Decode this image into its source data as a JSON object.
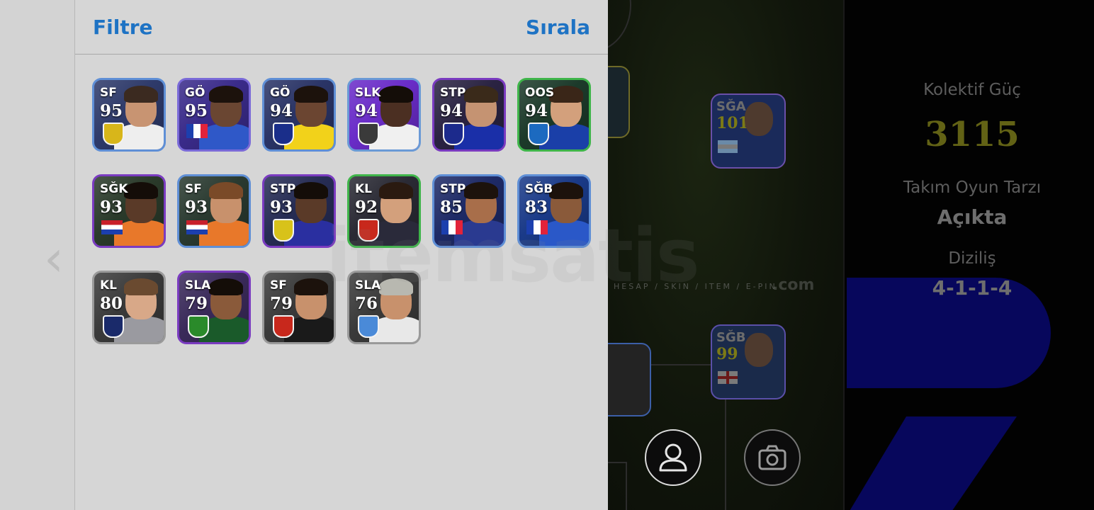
{
  "header": {
    "filter_label": "Filtre",
    "sort_label": "Sırala"
  },
  "nav": {
    "back_icon": "chevron-left-icon"
  },
  "players": [
    {
      "pos": "SF",
      "ovr": "95",
      "badge": "crest",
      "frame": "#5f8fd6",
      "bg": "#2e3a6a",
      "shirt": "#eeeeee",
      "skin": "#c89472",
      "hair": "#3b2a20",
      "crest": "#d8b61a"
    },
    {
      "pos": "GÖ",
      "ovr": "95",
      "badge": "flag-fr",
      "frame": "#7a6ad8",
      "bg": "#3a2b8a",
      "shirt": "#2f58c8",
      "skin": "#6a4632",
      "hair": "#1c120c",
      "crest": "#ffffff"
    },
    {
      "pos": "GÖ",
      "ovr": "94",
      "badge": "crest",
      "frame": "#5f8fd6",
      "bg": "#2a3466",
      "shirt": "#f2d21a",
      "skin": "#6b4531",
      "hair": "#1c120c",
      "crest": "#1a2e8a"
    },
    {
      "pos": "SLK",
      "ovr": "94",
      "badge": "crest",
      "frame": "#6a9ad6",
      "bg": "#6a2cc8",
      "shirt": "#f0f0f0",
      "skin": "#4b2f22",
      "hair": "#140d08",
      "crest": "#3a3a3a"
    },
    {
      "pos": "STP",
      "ovr": "94",
      "badge": "crest",
      "frame": "#7a3bc0",
      "bg": "#2a2342",
      "shirt": "#1a2fa8",
      "skin": "#c59372",
      "hair": "#3a2a1a",
      "crest": "#1c2a8c"
    },
    {
      "pos": "OOS",
      "ovr": "94",
      "badge": "crest",
      "frame": "#3fb54a",
      "bg": "#1c3a2a",
      "shirt": "#1a3fa8",
      "skin": "#d3a07c",
      "hair": "#3a2618",
      "crest": "#1c6ac0"
    },
    {
      "pos": "SĞK",
      "ovr": "93",
      "badge": "flag-nl",
      "frame": "#7a3bc0",
      "bg": "#2a3a2a",
      "shirt": "#e8782a",
      "skin": "#5a3a28",
      "hair": "#140d08",
      "crest": "#ffffff"
    },
    {
      "pos": "SF",
      "ovr": "93",
      "badge": "flag-nl",
      "frame": "#5f8fd6",
      "bg": "#2a3a30",
      "shirt": "#e8782a",
      "skin": "#c8916c",
      "hair": "#7a4a28",
      "crest": "#ffffff"
    },
    {
      "pos": "STP",
      "ovr": "93",
      "badge": "crest",
      "frame": "#7a3bc0",
      "bg": "#262c54",
      "shirt": "#2a2fa0",
      "skin": "#5a3a28",
      "hair": "#140d08",
      "crest": "#d8c21a"
    },
    {
      "pos": "KL",
      "ovr": "92",
      "badge": "crest",
      "frame": "#3fb54a",
      "bg": "#2a2a34",
      "shirt": "#2a2a3a",
      "skin": "#d3a07c",
      "hair": "#2a1a10",
      "crest": "#c8281c"
    },
    {
      "pos": "STP",
      "ovr": "85",
      "badge": "flag-fr",
      "frame": "#5f8fd6",
      "bg": "#1e2a66",
      "shirt": "#2a3a90",
      "skin": "#a86e4a",
      "hair": "#1c120c",
      "crest": "#ffffff"
    },
    {
      "pos": "SĞB",
      "ovr": "83",
      "badge": "flag-fr",
      "frame": "#5f8fd6",
      "bg": "#1a3a88",
      "shirt": "#2a58c8",
      "skin": "#8a5a3a",
      "hair": "#1c120c",
      "crest": "#ffffff"
    },
    {
      "pos": "KL",
      "ovr": "80",
      "badge": "crest",
      "frame": "#9a9a9a",
      "bg": "#3a3a3a",
      "shirt": "#9a9aa0",
      "skin": "#d8a888",
      "hair": "#6a4a30",
      "crest": "#1a2a6a"
    },
    {
      "pos": "SLA",
      "ovr": "79",
      "badge": "crest",
      "frame": "#7a3bc0",
      "bg": "#3a2a5a",
      "shirt": "#1a5a2a",
      "skin": "#8a5a3a",
      "hair": "#140d08",
      "crest": "#2a8a2a"
    },
    {
      "pos": "SF",
      "ovr": "79",
      "badge": "crest",
      "frame": "#9a9a9a",
      "bg": "#3a3a3a",
      "shirt": "#1a1a1a",
      "skin": "#c8916c",
      "hair": "#1c120c",
      "crest": "#c8281c"
    },
    {
      "pos": "SLA",
      "ovr": "76",
      "badge": "crest",
      "frame": "#9a9a9a",
      "bg": "#3a3a3a",
      "shirt": "#e8e8e8",
      "skin": "#c8916c",
      "hair": "#b8b8b0",
      "crest": "#4a8ad8"
    }
  ],
  "team": {
    "power_label": "Kolektif Güç",
    "power_value": "3115",
    "style_label": "Takım Oyun Tarzı",
    "style_value": "Açıkta",
    "formation_label": "Diziliş",
    "formation_value": "4-1-1-4"
  },
  "lineup": [
    {
      "pos": "SĞA",
      "ovr": "101",
      "badge": "flag-ar"
    },
    {
      "pos": "SĞB",
      "ovr": "99",
      "badge": "flag-en"
    }
  ],
  "watermark": {
    "brand": "itemsatis",
    "tagline": "HESAP / SKIN / ITEM / E-PIN",
    "suffix": ".com"
  },
  "buttons": {
    "profile_icon": "user-icon",
    "camera_icon": "camera-icon"
  },
  "colors": {
    "accent": "#1e73c4",
    "power": "#626215",
    "panel": "#d6d6d6",
    "watermark_blue": "#07075c"
  }
}
